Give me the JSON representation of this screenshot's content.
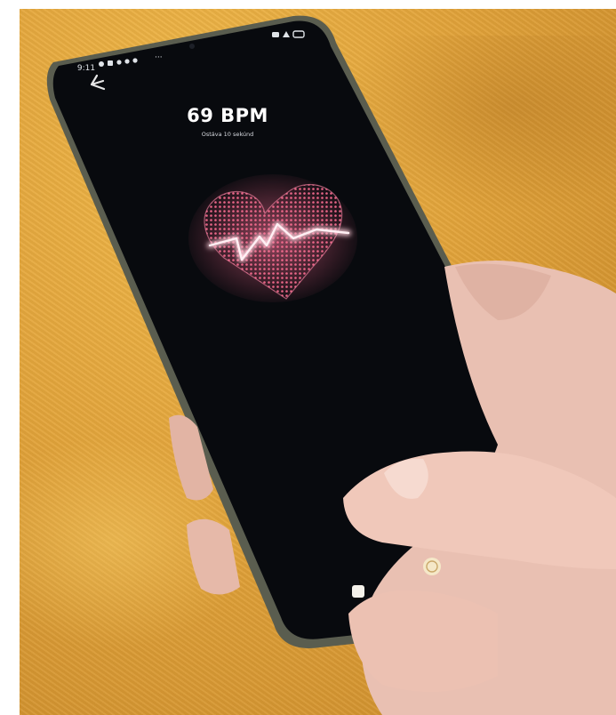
{
  "status_bar": {
    "time": "9:11",
    "notification_icons": [
      "settings-icon",
      "gallery-icon",
      "app-icon",
      "app-icon",
      "app-icon",
      "more-icon"
    ],
    "right_icons": [
      "sim-icon",
      "wifi-icon",
      "battery-icon"
    ]
  },
  "nav": {
    "back_icon": "back-arrow-icon"
  },
  "reading": {
    "value": "69 BPM",
    "subtitle": "Ostáva 10 sekúnd"
  },
  "graphic": {
    "icon": "heart-pulse-icon",
    "color": "#ff5f86"
  },
  "device": {
    "scanner_icon": "fingerprint-sensor-icon",
    "sensor_icon": "flash-icon"
  },
  "colors": {
    "screen": "#080a0e",
    "surface": "#e8a83c",
    "accent": "#ff5f86"
  }
}
